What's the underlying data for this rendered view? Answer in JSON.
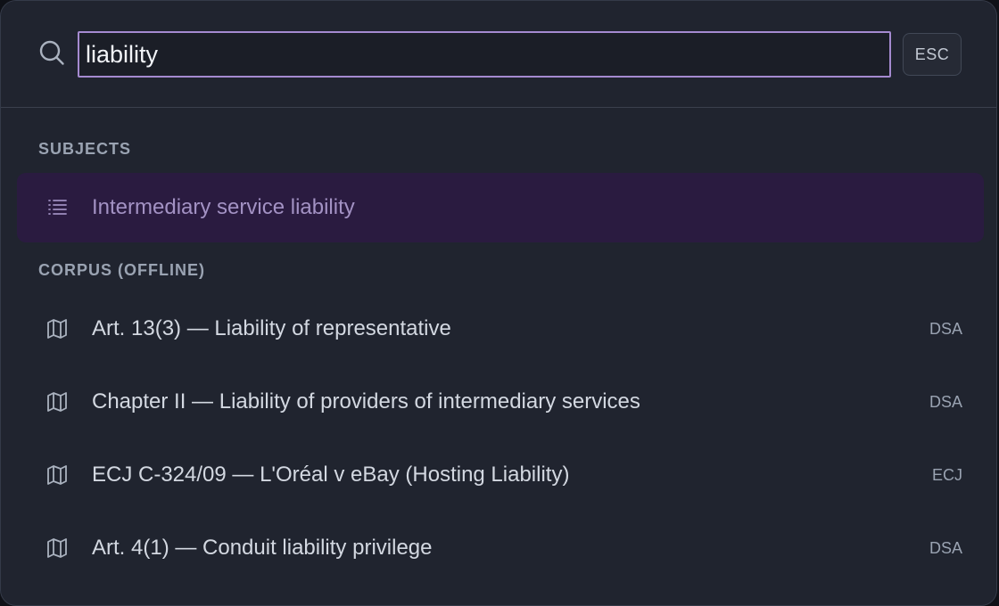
{
  "search": {
    "value": "liability",
    "esc_label": "ESC"
  },
  "sections": {
    "subjects": {
      "header": "SUBJECTS",
      "items": [
        {
          "label": "Intermediary service liability",
          "icon": "list-icon",
          "selected": true
        }
      ]
    },
    "corpus": {
      "header": "CORPUS (OFFLINE)",
      "items": [
        {
          "label": "Art. 13(3) — Liability of representative",
          "badge": "DSA",
          "icon": "map-icon"
        },
        {
          "label": "Chapter II — Liability of providers of intermediary services",
          "badge": "DSA",
          "icon": "map-icon"
        },
        {
          "label": "ECJ C-324/09 — L'Oréal v eBay (Hosting Liability)",
          "badge": "ECJ",
          "icon": "map-icon"
        },
        {
          "label": "Art. 4(1) — Conduit liability privilege",
          "badge": "DSA",
          "icon": "map-icon"
        }
      ]
    }
  },
  "colors": {
    "panel_bg": "#20242f",
    "input_border": "#a58ad0",
    "selected_bg": "#2a1b40",
    "selected_text": "#a392c4"
  }
}
